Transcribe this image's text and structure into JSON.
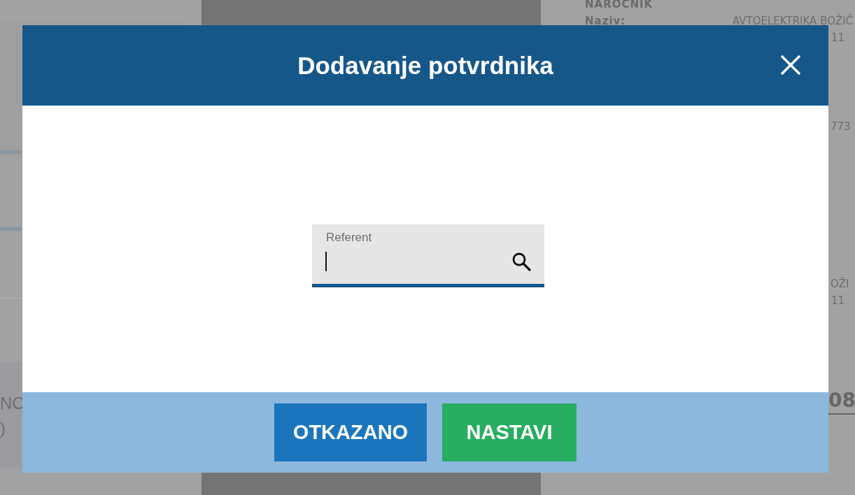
{
  "background": {
    "left_fragments": [
      "NO",
      ")"
    ],
    "customer": {
      "heading": "NAROCNIK",
      "name_label": "Naziv:",
      "name_value": "AVTOELEKTRIKA BOŽIČ",
      "lines": [
        {
          "kind": "plain",
          "text": "11"
        },
        {
          "kind": "plain",
          "text": "773"
        }
      ],
      "lines_lower": [
        {
          "kind": "plain",
          "text": "OŽI"
        },
        {
          "kind": "plain",
          "text": "11"
        }
      ],
      "total": "08"
    }
  },
  "dialog": {
    "title": "Dodavanje potvrdnika",
    "field": {
      "label": "Referent",
      "focused": true
    },
    "buttons": [
      {
        "label": "OTKAZANO",
        "kind": "cancel"
      },
      {
        "label": "NASTAVI",
        "kind": "confirm"
      }
    ]
  }
}
